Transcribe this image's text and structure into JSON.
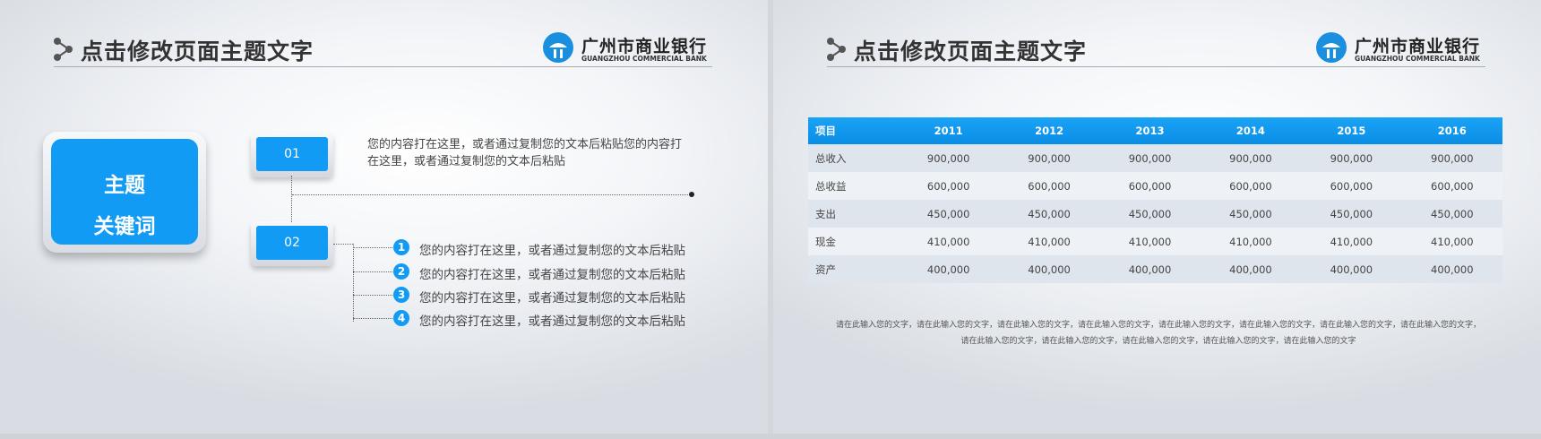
{
  "header": {
    "title": "点击修改页面主题文字",
    "logo_cn": "广州市商业银行",
    "logo_en": "GUANGZHOU COMMERCIAL BANK"
  },
  "left": {
    "topic_line1": "主题",
    "topic_line2": "关键词",
    "box1_label": "01",
    "box2_label": "02",
    "text1": "您的内容打在这里，或者通过复制您的文本后粘贴您的内容打在这里，或者通过复制您的文本后粘贴",
    "bullets": [
      {
        "num": "1",
        "text": "您的内容打在这里，或者通过复制您的文本后粘贴"
      },
      {
        "num": "2",
        "text": "您的内容打在这里，或者通过复制您的文本后粘贴"
      },
      {
        "num": "3",
        "text": "您的内容打在这里，或者通过复制您的文本后粘贴"
      },
      {
        "num": "4",
        "text": "您的内容打在这里，或者通过复制您的文本后粘贴"
      }
    ]
  },
  "right": {
    "table": {
      "headers": [
        "项目",
        "2011",
        "2012",
        "2013",
        "2014",
        "2015",
        "2016"
      ],
      "rows": [
        [
          "总收入",
          "900,000",
          "900,000",
          "900,000",
          "900,000",
          "900,000",
          "900,000"
        ],
        [
          "总收益",
          "600,000",
          "600,000",
          "600,000",
          "600,000",
          "600,000",
          "600,000"
        ],
        [
          "支出",
          "450,000",
          "450,000",
          "450,000",
          "450,000",
          "450,000",
          "450,000"
        ],
        [
          "现金",
          "410,000",
          "410,000",
          "410,000",
          "410,000",
          "410,000",
          "410,000"
        ],
        [
          "资产",
          "400,000",
          "400,000",
          "400,000",
          "400,000",
          "400,000",
          "400,000"
        ]
      ]
    },
    "footnote": "请在此输入您的文字，请在此输入您的文字，请在此输入您的文字，请在此输入您的文字，请在此输入您的文字，请在此输入您的文字，请在此输入您的文字，请在此输入您的文字，请在此输入您的文字，请在此输入您的文字，请在此输入您的文字，请在此输入您的文字，请在此输入您的文字"
  },
  "colors": {
    "accent": "#119bf5",
    "title": "#333333"
  },
  "icons": [
    "share-nodes-icon",
    "bank-logo-icon"
  ]
}
